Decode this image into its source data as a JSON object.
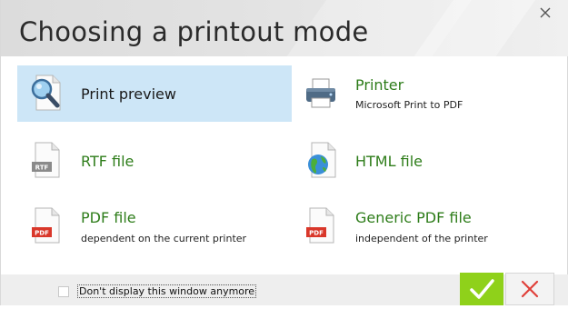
{
  "dialog": {
    "title": "Choosing a printout mode",
    "close_glyph": "×"
  },
  "options": [
    {
      "id": "print-preview",
      "label": "Print preview",
      "sub": "",
      "icon": "magnifier-page-icon",
      "selected": true
    },
    {
      "id": "printer",
      "label": "Printer",
      "sub": "Microsoft Print to PDF",
      "icon": "printer-icon",
      "selected": false
    },
    {
      "id": "rtf-file",
      "label": "RTF file",
      "sub": "",
      "icon": "rtf-file-icon",
      "badge": "RTF",
      "selected": false
    },
    {
      "id": "html-file",
      "label": "HTML file",
      "sub": "",
      "icon": "globe-file-icon",
      "selected": false
    },
    {
      "id": "pdf-file",
      "label": "PDF file",
      "sub": "dependent on the current printer",
      "icon": "pdf-file-icon",
      "badge": "PDF",
      "selected": false
    },
    {
      "id": "generic-pdf-file",
      "label": "Generic PDF file",
      "sub": "independent of the printer",
      "icon": "pdf-file-icon",
      "badge": "PDF",
      "selected": false
    }
  ],
  "footer": {
    "checkbox_label": "Don't display this window anymore",
    "checkbox_checked": false,
    "ok_icon": "checkmark-icon",
    "cancel_icon": "x-icon"
  },
  "colors": {
    "selection": "#cde6f7",
    "green_text": "#2e7d1a",
    "ok_button": "#8fd11a",
    "cancel_x": "#e0403a",
    "pdf_badge": "#d9372a"
  }
}
